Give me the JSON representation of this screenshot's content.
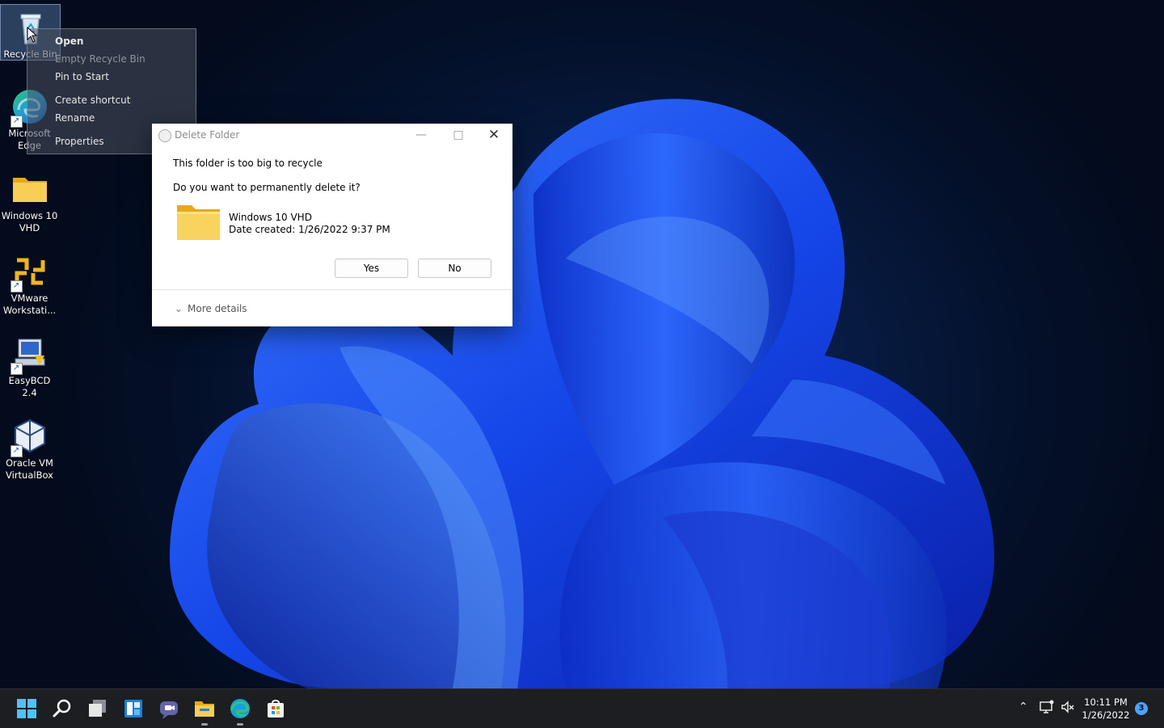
{
  "desktop": {
    "icons": [
      {
        "label": "Recycle Bin",
        "icon": "recycle-bin-icon"
      },
      {
        "label": "Microsoft Edge",
        "icon": "edge-icon"
      },
      {
        "label": "Windows 10 VHD",
        "icon": "folder-icon"
      },
      {
        "label": "VMware Workstati...",
        "icon": "vmware-icon"
      },
      {
        "label": "EasyBCD 2.4",
        "icon": "easybcd-icon"
      },
      {
        "label": "Oracle VM VirtualBox",
        "icon": "virtualbox-icon"
      }
    ]
  },
  "context_menu": {
    "items": [
      {
        "label": "Open",
        "state": "default"
      },
      {
        "label": "Empty Recycle Bin",
        "state": "disabled"
      },
      {
        "label": "Pin to Start",
        "state": "normal"
      },
      {
        "label": "Create shortcut",
        "state": "normal"
      },
      {
        "label": "Rename",
        "state": "normal"
      },
      {
        "label": "Properties",
        "state": "normal"
      }
    ]
  },
  "dialog": {
    "title": "Delete Folder",
    "message": "This folder is too big to recycle",
    "question": "Do you want to permanently delete it?",
    "item_name": "Windows 10 VHD",
    "item_date": "Date created: 1/26/2022 9:37 PM",
    "yes_label": "Yes",
    "no_label": "No",
    "more_details_label": "More details"
  },
  "taskbar": {
    "apps": [
      "start-icon",
      "search-icon",
      "task-view-icon",
      "widgets-icon",
      "chat-icon",
      "file-explorer-icon",
      "edge-icon",
      "store-icon"
    ],
    "clock_time": "10:11 PM",
    "clock_date": "1/26/2022",
    "notification_count": "3"
  },
  "colors": {
    "accent": "#0078d4",
    "folder_yellow": "#f5c542",
    "wallpaper_blue": "#1a4cff"
  }
}
